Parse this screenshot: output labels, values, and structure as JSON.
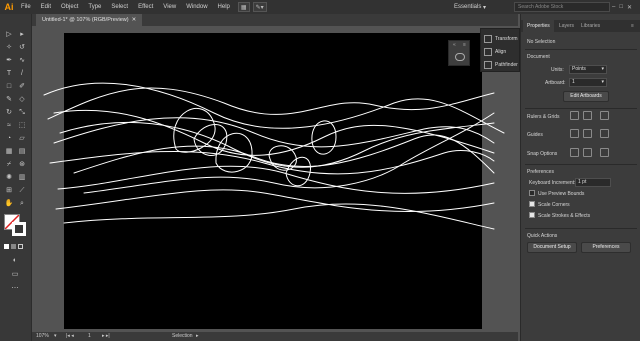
{
  "app": {
    "logo": "Ai"
  },
  "menu": [
    "File",
    "Edit",
    "Object",
    "Type",
    "Select",
    "Effect",
    "View",
    "Window",
    "Help"
  ],
  "workspace": "Essentials",
  "search_placeholder": "Search Adobe Stock",
  "window_controls": [
    "–",
    "□",
    "✕"
  ],
  "document_tab": "Untitled-1* @ 107% (RGB/Preview)",
  "status": {
    "zoom": "107%",
    "page": "1",
    "mode": "Selection"
  },
  "floating_panel": {
    "items": [
      "Transform",
      "Align",
      "Pathfinder"
    ]
  },
  "right_panel": {
    "tabs": [
      "Properties",
      "Layers",
      "Libraries"
    ],
    "selection": "No Selection",
    "document": {
      "title": "Document",
      "units_label": "Units:",
      "units_value": "Points",
      "artboard_label": "Artboard:",
      "artboard_value": "1",
      "edit_artboards": "Edit Artboards"
    },
    "rulers_grids": "Rulers & Grids",
    "guides": "Guides",
    "snap_options": "Snap Options",
    "preferences": {
      "title": "Preferences",
      "keyboard_increment_label": "Keyboard Increment:",
      "keyboard_increment_value": "1 pt",
      "use_preview_bounds": "Use Preview Bounds",
      "scale_corners": "Scale Corners",
      "scale_strokes": "Scale Strokes & Effects",
      "use_preview_bounds_checked": false,
      "scale_corners_checked": true,
      "scale_strokes_checked": true
    },
    "quick_actions": {
      "title": "Quick Actions",
      "document_setup": "Document Setup",
      "preferences_button": "Preferences"
    }
  },
  "colors": {
    "accent": "#ff9a00",
    "artboard": "#000000",
    "stroke": "#ffffff"
  }
}
